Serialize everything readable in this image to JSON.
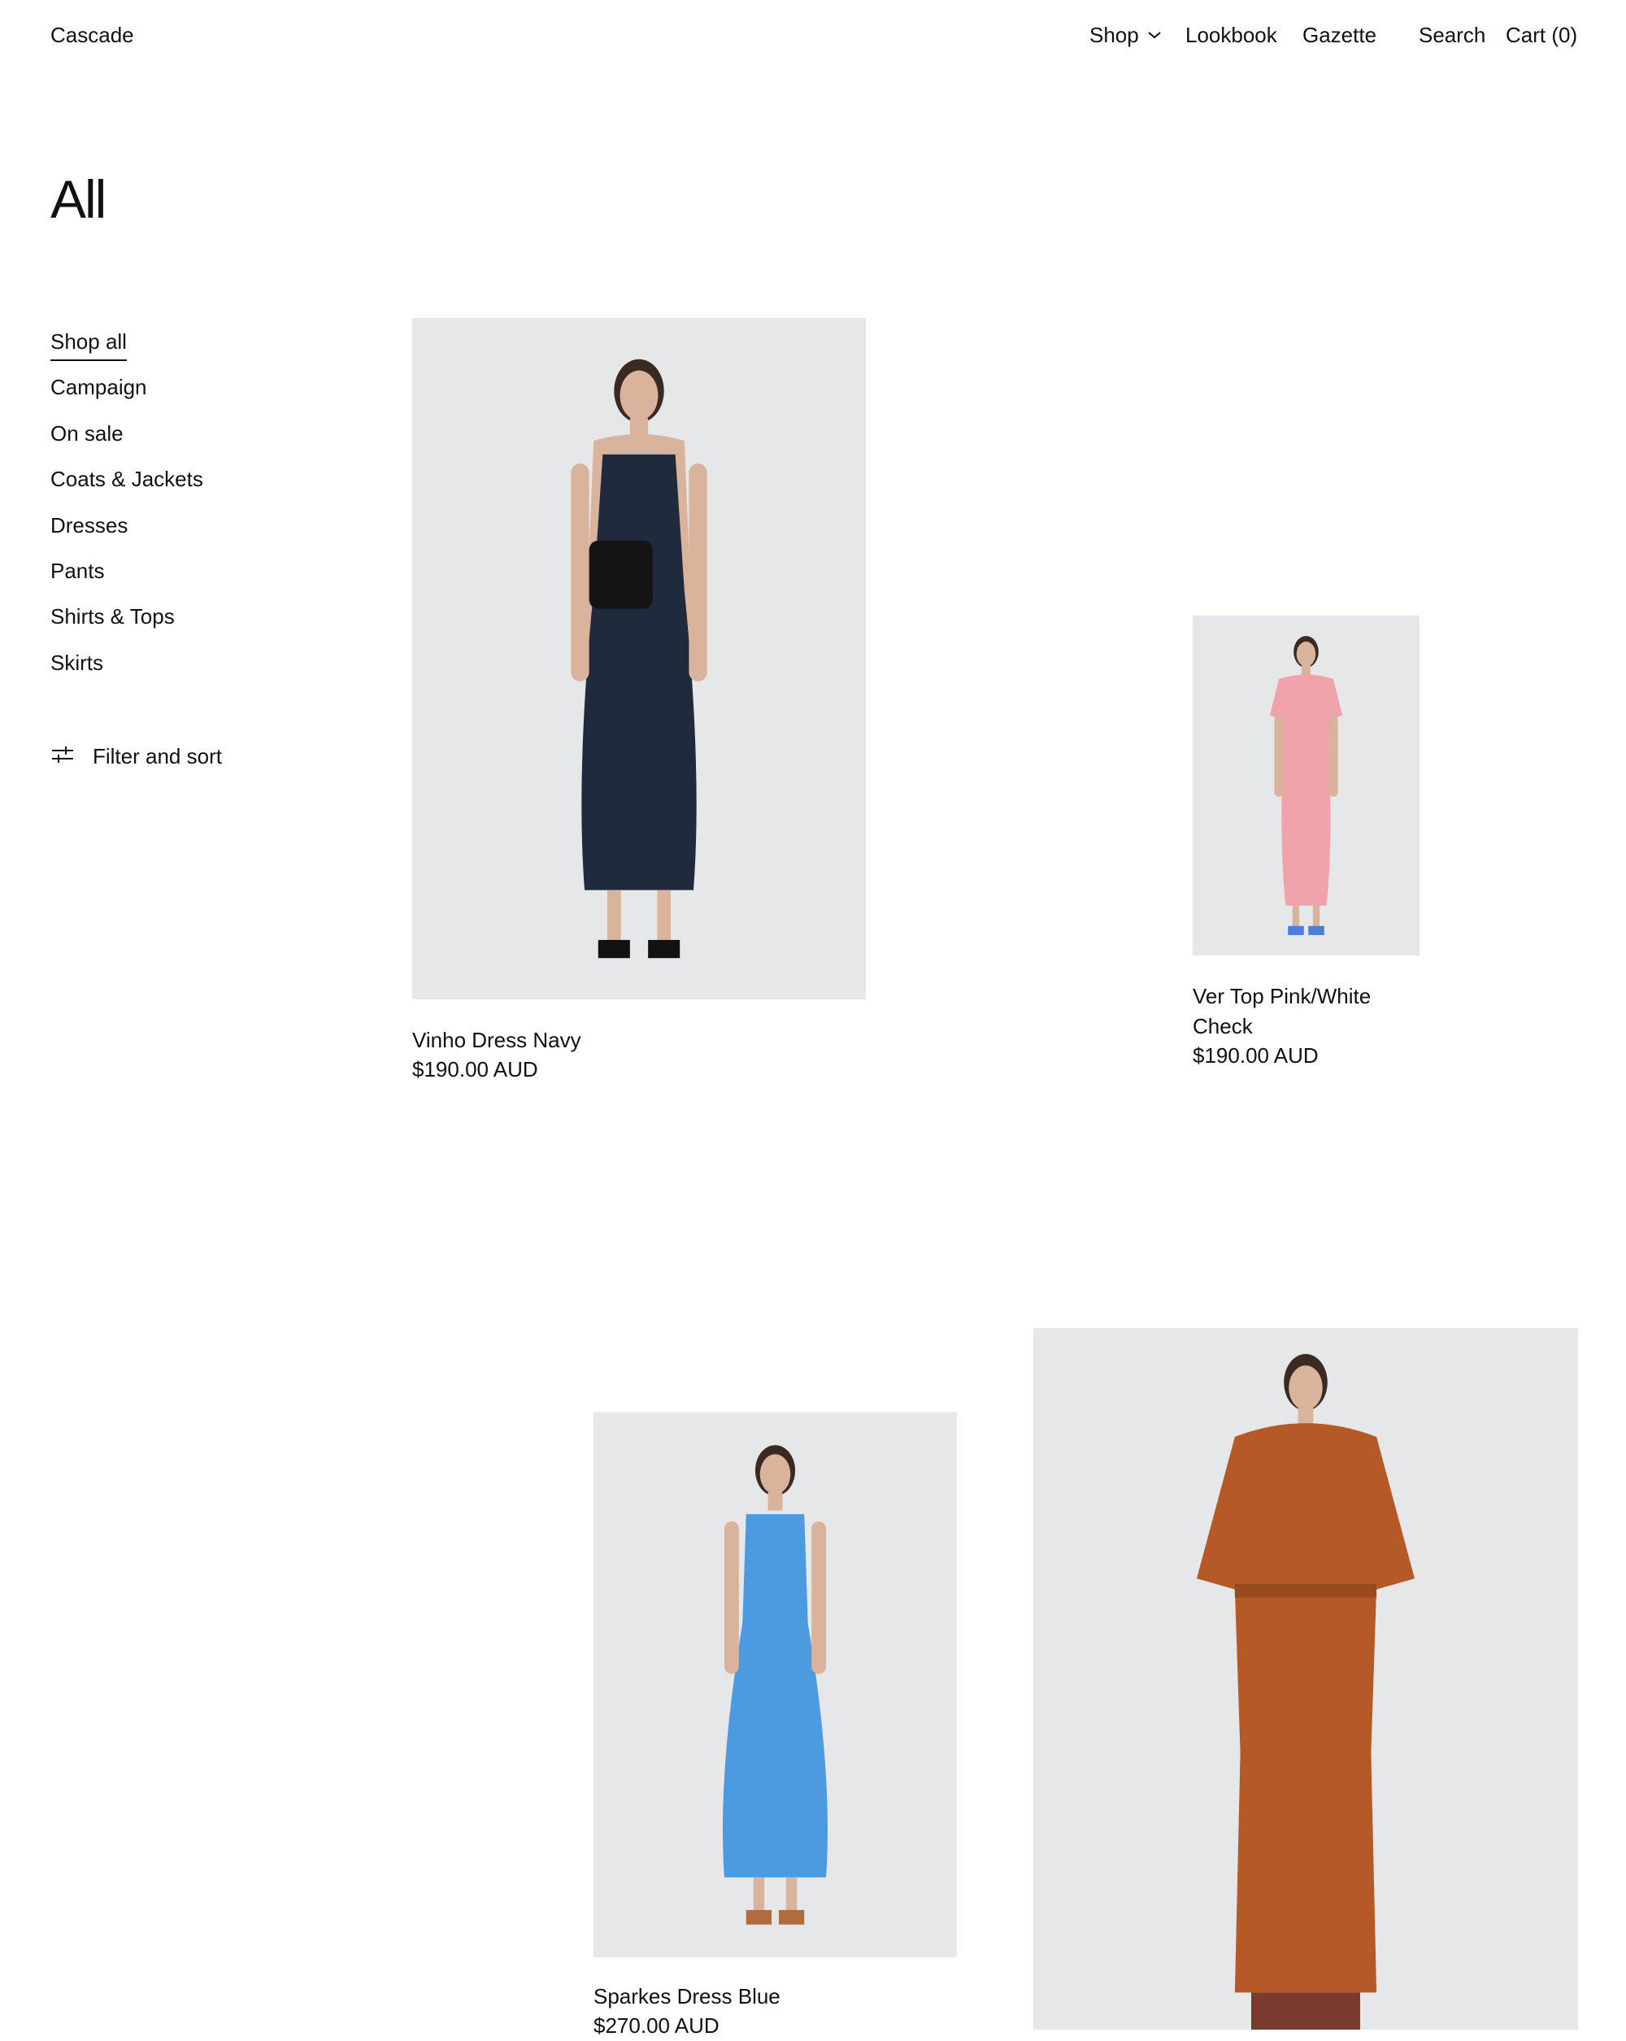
{
  "header": {
    "brand": "Cascade",
    "nav": {
      "shop": "Shop",
      "lookbook": "Lookbook",
      "gazette": "Gazette",
      "search": "Search",
      "cart": "Cart (0)"
    }
  },
  "page": {
    "title": "All"
  },
  "sidebar": {
    "categories": [
      {
        "label": "Shop all",
        "active": true
      },
      {
        "label": "Campaign"
      },
      {
        "label": "On sale"
      },
      {
        "label": "Coats & Jackets"
      },
      {
        "label": "Dresses"
      },
      {
        "label": "Pants"
      },
      {
        "label": "Shirts & Tops"
      },
      {
        "label": "Skirts"
      }
    ],
    "filter_label": "Filter and sort"
  },
  "products": [
    {
      "title": "Vinho Dress Navy",
      "price": "$190.00 AUD",
      "garment_color": "#1f2a3d"
    },
    {
      "title_line1": "Ver Top Pink/White",
      "title_line2": "Check",
      "price": "$190.00 AUD",
      "garment_color": "#f0a3aa"
    },
    {
      "title": "Sparkes Dress Blue",
      "price": "$270.00 AUD",
      "garment_color": "#4c9be0"
    },
    {
      "title": "",
      "price": "",
      "garment_color": "#b55a27"
    }
  ],
  "colors": {
    "text": "#111111",
    "photo_bg": "#e6e7e9",
    "skin": "#d9b39b",
    "hair": "#3a2a22"
  },
  "icons": {
    "shop_menu": "chevron-down-icon",
    "filter": "sliders-icon"
  }
}
